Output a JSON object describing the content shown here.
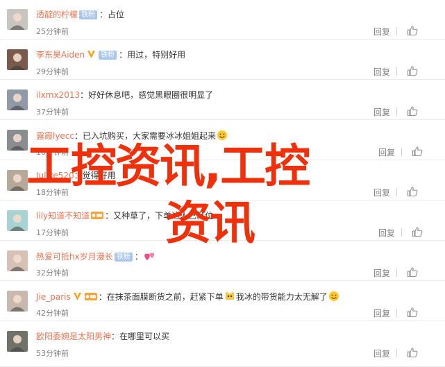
{
  "comments": [
    {
      "username": "透靛的柠檬",
      "has_v": false,
      "badge": "铁粉",
      "vip": false,
      "colon": "：",
      "text": "占位",
      "emoji_after": "",
      "time": "25分钟前",
      "reply": "回复",
      "avatar_color": "#c9c4bf"
    },
    {
      "username": "李东昊Aiden",
      "has_v": true,
      "badge": "铁粉",
      "vip": false,
      "colon": "：",
      "text": "用过，特别好用",
      "emoji_after": "",
      "time": "29分钟前",
      "reply": "回复",
      "avatar_color": "#7a5a4d"
    },
    {
      "username": "ilxmx2013",
      "has_v": false,
      "badge": "",
      "vip": false,
      "colon": "：",
      "text": "好好休息吧，感觉黑眼圈很明显了",
      "emoji_after": "",
      "time": "37分钟前",
      "reply": "回复",
      "avatar_color": "#8f99a8"
    },
    {
      "username": "露霞lyecc",
      "has_v": false,
      "badge": "",
      "vip": false,
      "colon": "：",
      "text": "已入坑购买，大家需要冰冰姐姐起来",
      "emoji_after": "smile",
      "time": "16分钟前",
      "reply": "回复",
      "avatar_color": "#8a8d90"
    },
    {
      "username": "Julike520",
      "has_v": false,
      "badge": "",
      "vip": false,
      "colon": "：",
      "text": "觉得好用",
      "emoji_after": "",
      "time": "18分钟前",
      "reply": "回复",
      "avatar_color": "#b7a99a"
    },
    {
      "username": "lily知道不知道",
      "has_v": false,
      "badge": "",
      "vip": true,
      "colon": "：",
      "text": "又种草了，下单达人已就位",
      "emoji_after": "",
      "time": "17分钟前",
      "reply": "回复",
      "avatar_color": "#a7d4d2"
    },
    {
      "username": "热爱可抵hx岁月漫长",
      "has_v": false,
      "badge": "铁粉",
      "vip": false,
      "colon": "：",
      "text": "",
      "emoji_after": "hearts",
      "time": "32分钟前",
      "reply": "回复",
      "avatar_color": "#d7c0b5"
    },
    {
      "username": "Jie_paris",
      "has_v": true,
      "badge": "",
      "vip": true,
      "colon": "：",
      "text": "在抹茶面膜断货之前，赶紧下单",
      "emoji_after": "cat",
      "text2": "我冰的带货能力太无解了",
      "emoji_end": "smile",
      "time": "42分钟前",
      "reply": "回复",
      "avatar_color": "#c8b8ad"
    },
    {
      "username": "欧阳委婉是太阳男神",
      "has_v": false,
      "badge": "",
      "vip": false,
      "colon": "：",
      "text": "在哪里可以买",
      "emoji_after": "",
      "time": "53分钟前",
      "reply": "回复",
      "avatar_color": "#6f7266"
    }
  ],
  "watermark": {
    "line1": "工控资讯,工控",
    "line2": "资讯",
    "color": "#f0300a"
  }
}
